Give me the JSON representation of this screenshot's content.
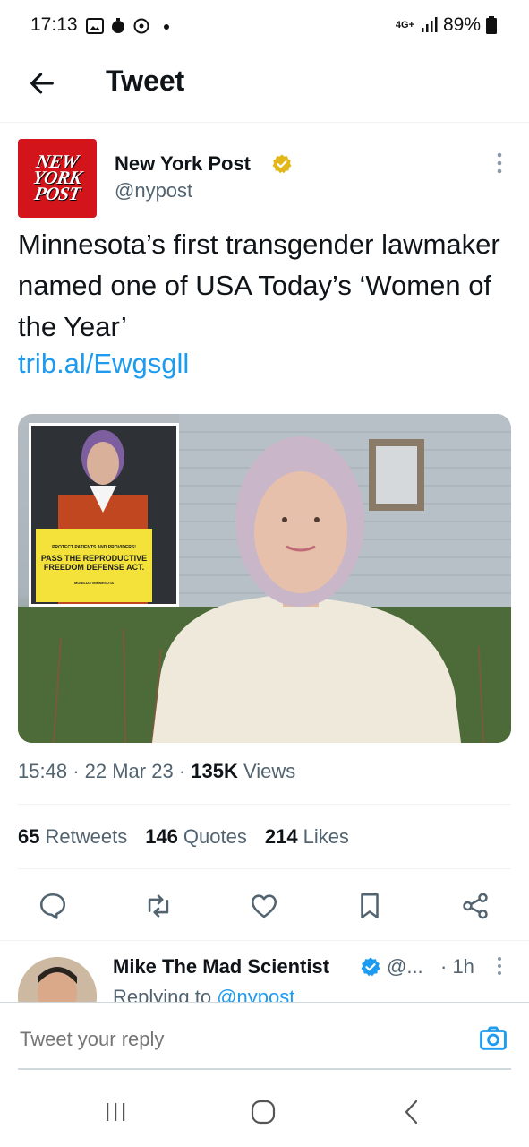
{
  "status_bar": {
    "time": "17:13",
    "network": "4G+",
    "battery": "89%"
  },
  "header": {
    "title": "Tweet"
  },
  "tweet": {
    "avatar_logo_lines": [
      "NEW",
      "YORK",
      "POST"
    ],
    "author_name": "New York Post",
    "author_handle": "@nypost",
    "text": "Minnesota’s first transgender lawmaker named one of USA Today’s ‘Women of the Year’",
    "link": "trib.al/Ewgsgll",
    "media": {
      "inset_sign_lines": [
        "PROTECT PATIENTS AND PROVIDERS!",
        "PASS THE REPRODUCTIVE",
        "FREEDOM DEFENSE ACT."
      ],
      "inset_sign_footer": "MOBILIZE MINNESOTA"
    },
    "time": "15:48",
    "date": "22 Mar 23",
    "views_count": "135K",
    "views_label": "Views",
    "stats": [
      {
        "count": "65",
        "label": "Retweets"
      },
      {
        "count": "146",
        "label": "Quotes"
      },
      {
        "count": "214",
        "label": "Likes"
      }
    ]
  },
  "reply_preview": {
    "name": "Mike The Mad Scientist",
    "handle": "@...",
    "time": "· 1h",
    "replying_prefix": "Replying to",
    "replying_handle": "@nypost"
  },
  "composer": {
    "placeholder": "Tweet your reply"
  },
  "icons": {
    "back": "arrow-left-icon",
    "more": "more-vertical-icon",
    "verified_gold": "verified-gold-icon",
    "verified_blue": "verified-blue-icon",
    "reply": "comment-icon",
    "retweet": "retweet-icon",
    "like": "heart-icon",
    "bookmark": "bookmark-icon",
    "share": "share-icon",
    "camera": "camera-icon"
  },
  "colors": {
    "accent": "#1d9bf0",
    "text": "#0f1419",
    "secondary": "#536471",
    "brand_red": "#d3141b",
    "verified_gold": "#e2b719"
  }
}
